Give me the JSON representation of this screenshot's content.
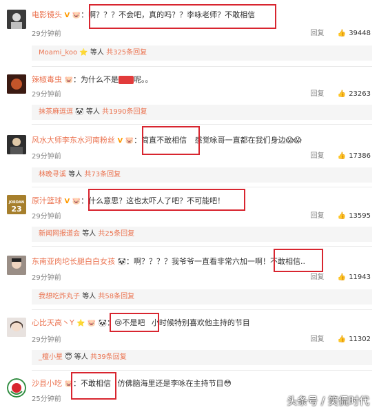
{
  "comments": [
    {
      "username": "电影镜头",
      "badges": "V 🐷",
      "colon": "：",
      "text": "啊？？？不会吧，真的吗？？李咏老师？不敢相信",
      "time": "29分钟前",
      "reply_label": "回复",
      "likes": "39448",
      "reply_summary": {
        "name": "Moami_koo",
        "icon": "⭐",
        "mid": " 等人 ",
        "link": "共325条回复"
      }
    },
    {
      "username": "辣椒毒虫",
      "badges": "🐷",
      "colon": "：",
      "text_before": "为什么不是",
      "text_after": "呢。。",
      "time": "29分钟前",
      "reply_label": "回复",
      "likes": "23263",
      "reply_summary": {
        "name": "抹茶麻逗逗",
        "icon": "🐼",
        "mid": " 等人 ",
        "link": "共1990条回复"
      }
    },
    {
      "username": "风水大师李东水河南粉丝",
      "badges": "V 🐷",
      "colon": "：",
      "text_highlight": "简直不敢相信",
      "text_rest": "感觉咏哥一直都在我们身边😱😱",
      "time": "29分钟前",
      "reply_label": "回复",
      "likes": "17386",
      "reply_summary": {
        "name": "林晚寻溪",
        "icon": "",
        "mid": " 等人 ",
        "link": "共73条回复"
      }
    },
    {
      "username": "原汁篮球",
      "badges": "V 🐷",
      "colon": "：",
      "text": "什么意思？这也太吓人了吧？不可能吧！",
      "time": "29分钟前",
      "reply_label": "回复",
      "likes": "13595",
      "reply_summary": {
        "name": "新闻网报道会",
        "icon": "",
        "mid": " 等人 ",
        "link": "共25条回复"
      }
    },
    {
      "username": "东南亚肉坨长腿白白女孩",
      "badges": "🐼",
      "colon": "：",
      "text_rest": "啊？？？？我爷爷一直看非常六加一啊！",
      "text_highlight": "不敢相信..",
      "time": "29分钟前",
      "reply_label": "回复",
      "likes": "11943",
      "reply_summary": {
        "name": "我想吃炸丸子",
        "icon": "",
        "mid": " 等人 ",
        "link": "共58条回复"
      }
    },
    {
      "username": "心比天高丶Y",
      "badges": "⭐ 🐷 🐼",
      "colon": "：",
      "text_highlight": "😢不是吧",
      "text_rest": "小时候特别喜欢他主持的节目",
      "time": "29分钟前",
      "reply_label": "回复",
      "likes": "11302",
      "reply_summary": {
        "name": "_檀小星",
        "icon": "😇",
        "mid": " 等人 ",
        "link": "共39条回复"
      }
    },
    {
      "username": "沙县小吃",
      "badges": "🐷",
      "colon": "：",
      "text_highlight": "不敢相信",
      "text_rest": "仿佛脑海里还是李咏在主持节目😳",
      "time": "25分钟前"
    }
  ],
  "colors": {
    "username": "#eb7350",
    "highlight_box": "#d8252f",
    "reply_bg": "#f5f5f5"
  },
  "watermark": "头条号 / 笑侃时代"
}
